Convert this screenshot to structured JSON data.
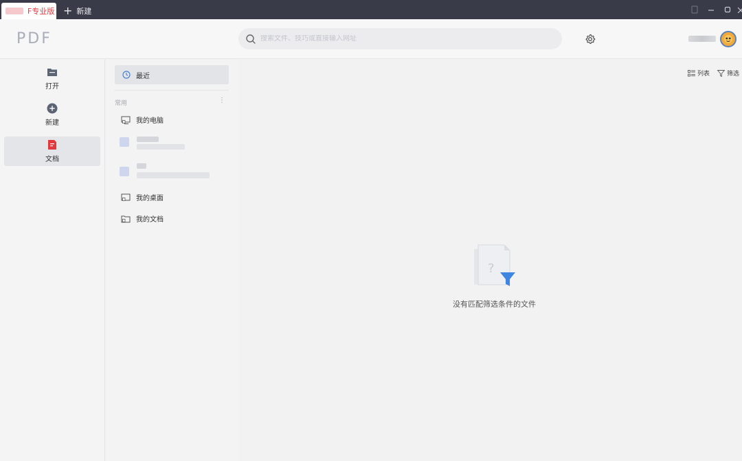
{
  "titlebar": {
    "active_tab_label": "F专业版",
    "new_tab_label": "新建"
  },
  "header": {
    "logo": "PDF",
    "search_placeholder": "搜索文件、技巧或直接输入网址"
  },
  "leftnav": {
    "items": [
      {
        "label": "打开",
        "icon": "folder-open-icon"
      },
      {
        "label": "新建",
        "icon": "plus-circle-icon"
      },
      {
        "label": "文档",
        "icon": "document-icon",
        "active": true
      }
    ]
  },
  "folders": {
    "recent_label": "最近",
    "section_label": "常用",
    "items": [
      {
        "label": "我的电脑",
        "icon": "computer-icon"
      },
      {
        "label": "我的桌面",
        "icon": "desktop-icon"
      },
      {
        "label": "我的文档",
        "icon": "documents-folder-icon"
      }
    ]
  },
  "main": {
    "list_label": "列表",
    "filter_label": "筛选",
    "empty_message": "没有匹配筛选条件的文件"
  },
  "colors": {
    "accent_red": "#e0393e",
    "filter_blue": "#3f86e0",
    "titlebar_bg": "#393b48"
  }
}
